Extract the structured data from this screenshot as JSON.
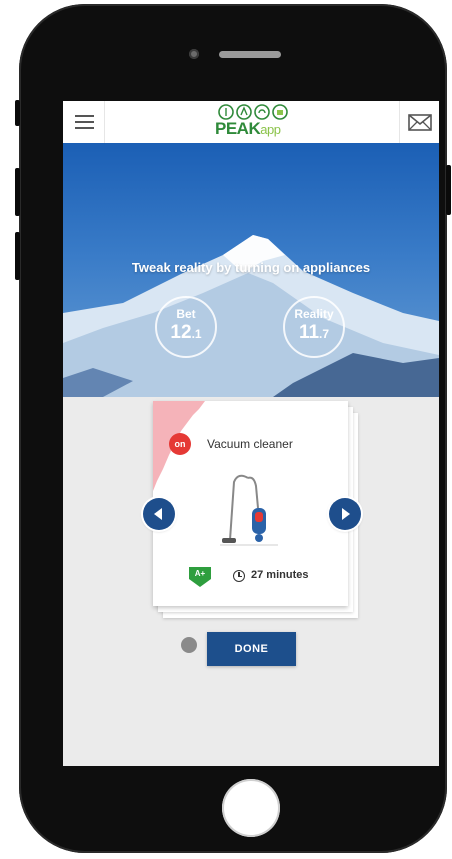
{
  "app": {
    "logo_name": "PEAK",
    "logo_suffix": "app"
  },
  "hero": {
    "tagline": "Tweak reality by turning on appliances",
    "bet": {
      "label": "Bet",
      "value": "12",
      "decimal": ".1"
    },
    "reality": {
      "label": "Reality",
      "value": "11",
      "decimal": ".7"
    }
  },
  "appliance_card": {
    "status": "on",
    "name": "Vacuum cleaner",
    "energy_class": "A+",
    "duration": "27 minutes"
  },
  "actions": {
    "done_label": "DONE"
  },
  "colors": {
    "primary_blue": "#1d4f8c",
    "on_red": "#e53935",
    "energy_green": "#2e9e3e",
    "logo_green": "#2f8a3a"
  },
  "icons": [
    "hamburger-menu-icon",
    "mail-icon",
    "clock-icon",
    "chevron-left-icon",
    "chevron-right-icon",
    "vacuum-cleaner-illustration",
    "energy-label-icon"
  ]
}
